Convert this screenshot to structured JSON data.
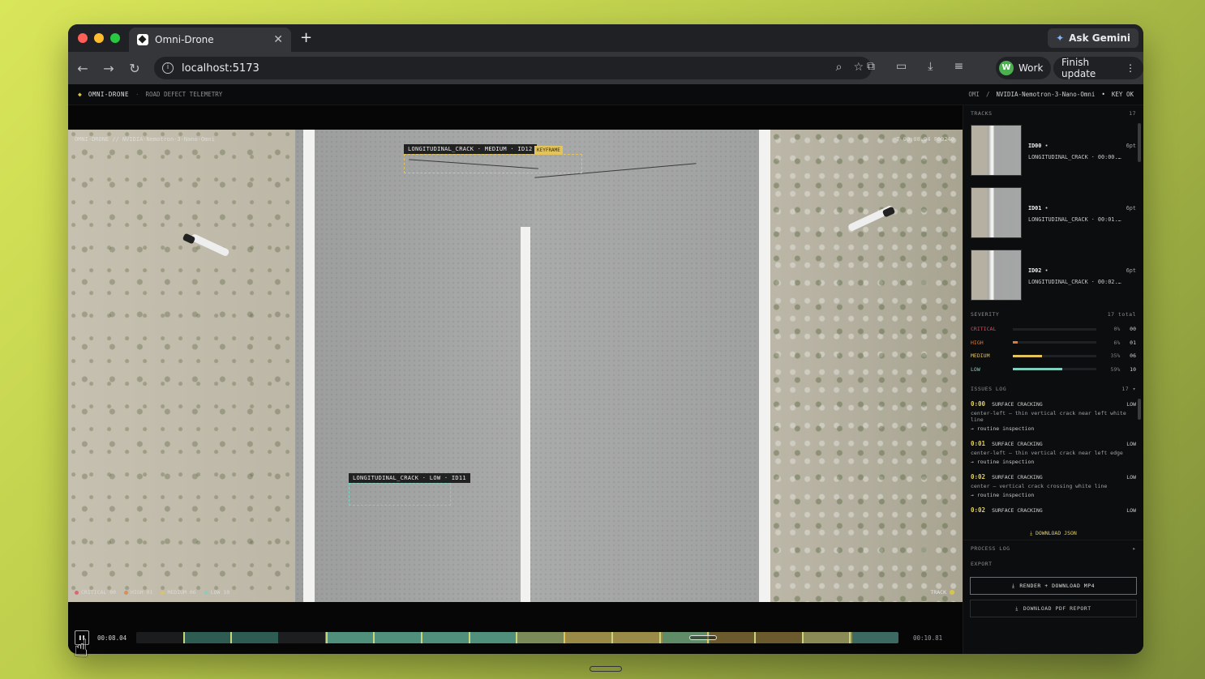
{
  "browser": {
    "tab_title": "Omni-Drone",
    "url": "localhost:5173",
    "gemini_label": "Ask Gemini",
    "profile_initial": "W",
    "profile_name": "Work",
    "update_label": "Finish update"
  },
  "app": {
    "brand": "OMNI-DRONE",
    "subtitle": "ROAD DEFECT TELEMETRY",
    "hdr_omni": "OMI",
    "hdr_slash": "/",
    "model": "NVIDIA-Nemotron-3-Nano-Omni",
    "key_status": "KEY OK"
  },
  "video": {
    "overlay_left": "OMNI-DRONE  //  NVIDIA-Nemotron-3-Nano-Omni",
    "overlay_right": "T 00:08.04   F00240",
    "boxes": [
      {
        "label": "LONGITUDINAL_CRACK · MEDIUM · ID12",
        "tag": "KEYFRAME",
        "color": "#e3c35a"
      },
      {
        "label": "LONGITUDINAL_CRACK · LOW · ID11",
        "color": "#7fd0bf"
      }
    ],
    "legend": [
      {
        "label": "CRITICAL  00",
        "color": "#e0455a"
      },
      {
        "label": "HIGH  01",
        "color": "#e07a3a"
      },
      {
        "label": "MEDIUM  06",
        "color": "#e3c35a"
      },
      {
        "label": "LOW  10",
        "color": "#7fd0bf"
      }
    ],
    "track_label": "TRACK"
  },
  "timeline": {
    "play_icon": "play-pause-icon",
    "current": "00:08.04",
    "end": "00:10.81",
    "position": 0.744
  },
  "tracks": {
    "title": "TRACKS",
    "count": "17",
    "items": [
      {
        "id": "ID00",
        "dot": "•",
        "pts": "6pt",
        "cls": "LONGITUDINAL_CRACK · 00:00.…"
      },
      {
        "id": "ID01",
        "dot": "•",
        "pts": "6pt",
        "cls": "LONGITUDINAL_CRACK · 00:01.…"
      },
      {
        "id": "ID02",
        "dot": "•",
        "pts": "6pt",
        "cls": "LONGITUDINAL_CRACK · 00:02.…"
      }
    ]
  },
  "severity": {
    "title": "SEVERITY",
    "total": "17 total",
    "rows": [
      {
        "name": "CRITICAL",
        "pct": "0%",
        "count": "00",
        "fraction": 0.0,
        "color": "#e0455a"
      },
      {
        "name": "HIGH",
        "pct": "6%",
        "count": "01",
        "fraction": 0.06,
        "color": "#e07a3a"
      },
      {
        "name": "MEDIUM",
        "pct": "35%",
        "count": "06",
        "fraction": 0.35,
        "color": "#e3c35a"
      },
      {
        "name": "LOW",
        "pct": "59%",
        "count": "10",
        "fraction": 0.59,
        "color": "#7fd0bf"
      }
    ]
  },
  "issues": {
    "title": "ISSUES LOG",
    "count": "17 ▾",
    "items": [
      {
        "time": "0:00",
        "type": "SURFACE CRACKING",
        "sev": "LOW",
        "desc": "center-left — thin vertical crack near left white line",
        "action": "→ routine inspection"
      },
      {
        "time": "0:01",
        "type": "SURFACE CRACKING",
        "sev": "LOW",
        "desc": "center-left — thin vertical crack near left edge",
        "action": "→ routine inspection"
      },
      {
        "time": "0:02",
        "type": "SURFACE CRACKING",
        "sev": "LOW",
        "desc": "center — vertical crack crossing white line",
        "action": "→ routine inspection"
      },
      {
        "time": "0:02",
        "type": "SURFACE CRACKING",
        "sev": "LOW",
        "desc": "",
        "action": ""
      }
    ],
    "download_json": "DOWNLOAD JSON"
  },
  "process_log": {
    "title": "PROCESS LOG",
    "arrow": "▸"
  },
  "export": {
    "title": "EXPORT",
    "mp4": "RENDER + DOWNLOAD MP4",
    "pdf": "DOWNLOAD PDF REPORT"
  }
}
